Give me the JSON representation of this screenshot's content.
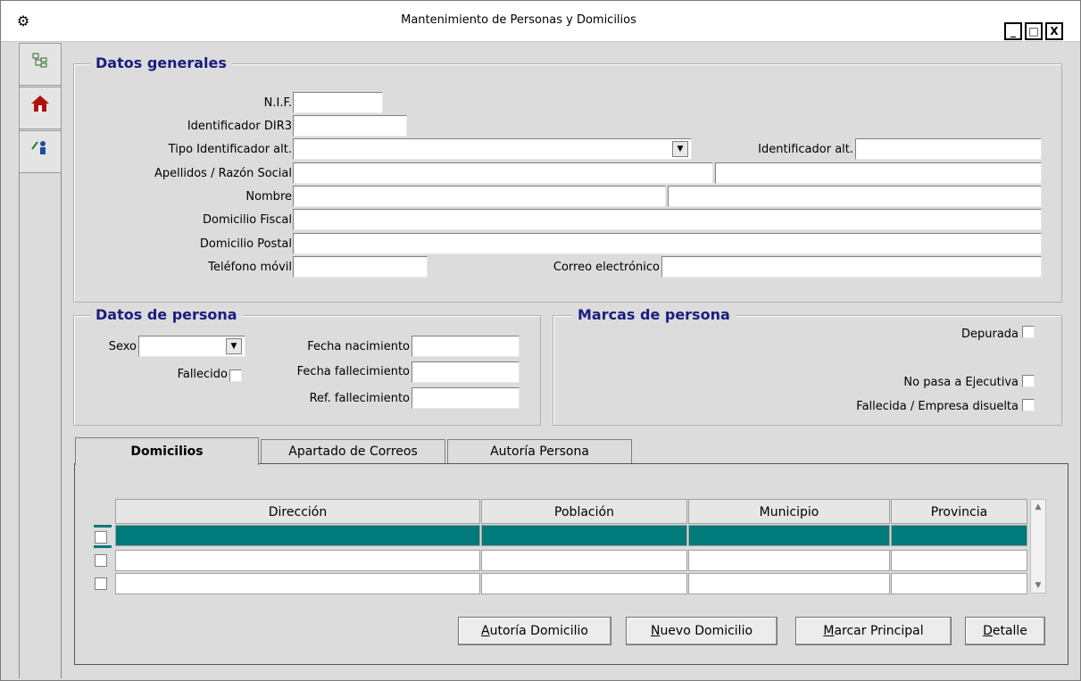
{
  "window": {
    "title": "Mantenimiento de Personas y Domicilios",
    "minimize": "_",
    "maximize": "□",
    "close": "X"
  },
  "icons": {
    "app": "gear-person-icon",
    "tree": "tree-icon",
    "house": "house-icon",
    "person_edit": "person-edit-icon"
  },
  "datos_generales": {
    "title": "Datos generales",
    "nif_label": "N.I.F.",
    "dir3_label": "Identificador DIR3",
    "tipo_label": "Tipo Identificador alt.",
    "ident_alt_label": "Identificador alt.",
    "apellidos_label": "Apellidos / Razón Social",
    "nombre_label": "Nombre",
    "dom_fiscal_label": "Domicilio Fiscal",
    "dom_postal_label": "Domicilio Postal",
    "movil_label": "Teléfono móvil",
    "correo_label": "Correo electrónico",
    "values": {
      "nif": "",
      "dir3": "",
      "tipo": "",
      "ident_alt": "",
      "apellidos": "",
      "apellidos2": "",
      "nombre": "",
      "nombre2": "",
      "dom_fiscal": "",
      "dom_postal": "",
      "movil": "",
      "correo": ""
    }
  },
  "datos_persona": {
    "title": "Datos de persona",
    "sexo_label": "Sexo",
    "fallecido_label": "Fallecido",
    "fecha_nac_label": "Fecha nacimiento",
    "fecha_fall_label": "Fecha fallecimiento",
    "ref_fall_label": "Ref. fallecimiento"
  },
  "marcas_persona": {
    "title": "Marcas de persona",
    "depurada_label": "Depurada",
    "ejecutiva_label": "No pasa a Ejecutiva",
    "disuelta_label": "Fallecida / Empresa disuelta"
  },
  "tabs": [
    {
      "label": "Domicilios",
      "active": true
    },
    {
      "label": "Apartado de Correos",
      "active": false
    },
    {
      "label": "Autoría Persona",
      "active": false
    }
  ],
  "table": {
    "columns": [
      "Dirección",
      "Población",
      "Municipio",
      "Provincia"
    ]
  },
  "buttons": {
    "autoria_u": "A",
    "autoria_rest": "utoría Domicilio",
    "nuevo_u": "N",
    "nuevo_rest": "uevo Domicilio",
    "marcar_u": "M",
    "marcar_rest": "arcar Principal",
    "detalle_u": "D",
    "detalle_rest": "etalle"
  }
}
